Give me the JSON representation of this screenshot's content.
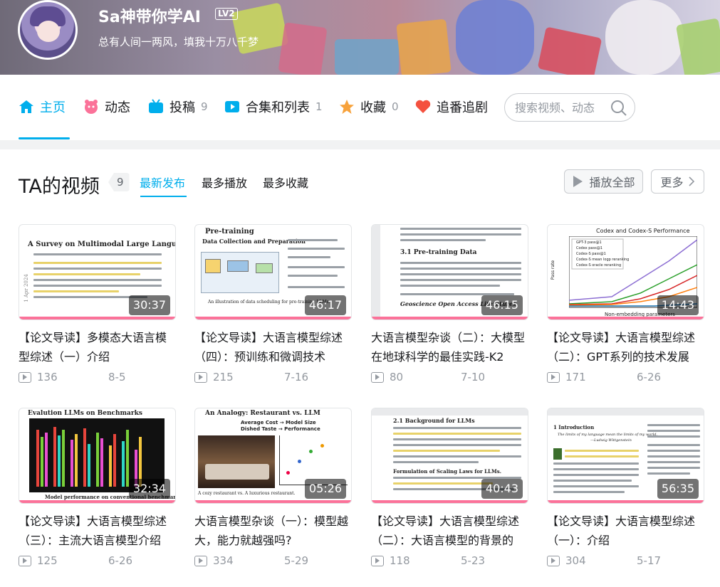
{
  "header": {
    "user_name": "Sa神带你学AI",
    "level": "LV2",
    "signature": "总有人间一两风，填我十万八千梦"
  },
  "nav": {
    "home": {
      "label": "主页"
    },
    "dynamic": {
      "label": "动态"
    },
    "posts": {
      "label": "投稿",
      "count": "9"
    },
    "collections": {
      "label": "合集和列表",
      "count": "1"
    },
    "favorites": {
      "label": "收藏",
      "count": "0"
    },
    "bangumi": {
      "label": "追番追剧"
    },
    "search_placeholder": "搜索视频、动态"
  },
  "colors": {
    "accent": "#00aeec",
    "pink": "#fb7299"
  },
  "section": {
    "title": "TA的视频",
    "count": "9",
    "sort_tabs": [
      "最新发布",
      "最多播放",
      "最多收藏"
    ],
    "play_all": "播放全部",
    "more": "更多"
  },
  "videos": [
    {
      "duration": "30:37",
      "title": "【论文导读】多模态大语言模型综述（一）介绍",
      "plays": "136",
      "date": "8-5",
      "thumb": {
        "heading": "A Survey on Multimodal Large Language Models",
        "side": "1 Apr 2024"
      }
    },
    {
      "duration": "46:17",
      "title": "【论文导读】大语言模型综述（四）：预训练和微调技术",
      "plays": "215",
      "date": "7-16",
      "thumb": {
        "heading": "Pre-training",
        "sub": "Data Collection and Preparation",
        "caption": "An illustration of data scheduling for pre-training LLMs."
      }
    },
    {
      "duration": "46:15",
      "title": "大语言模型杂谈（二）：大模型在地球科学的最佳实践-K2",
      "plays": "80",
      "date": "7-10",
      "thumb": {
        "heading": "3.1   Pre-training Data",
        "sub": "Geoscience Open Access Literatures."
      }
    },
    {
      "duration": "14:43",
      "title": "【论文导读】大语言模型综述（二）：GPT系列的技术发展",
      "plays": "171",
      "date": "6-26",
      "thumb": {
        "heading": "Codex and Codex-S Performance",
        "xlabel": "Non-embedding parameters",
        "ylabel": "Pass rate",
        "legend": [
          "GPT-3 pass@1",
          "Codex pass@1",
          "Codex-S pass@1",
          "Codex-S mean logp reranking",
          "Codex-S oracle reranking"
        ]
      }
    },
    {
      "duration": "32:34",
      "title": "【论文导读】大语言模型综述（三）：主流大语言模型介绍",
      "plays": "125",
      "date": "6-26",
      "thumb": {
        "heading": "Evalution LLMs on Benchmarks",
        "caption": "Model performance on conventional benchmarks"
      }
    },
    {
      "duration": "05:26",
      "title": "大语言模型杂谈（一）：模型越大，能力就越强吗?",
      "plays": "334",
      "date": "5-29",
      "thumb": {
        "heading": "An Analogy: Restaurant vs. LLM",
        "line1": "Average Cost → Model Size",
        "line2": "Dished Taste → Performance",
        "caption": "A cozy restaurant vs. A luxurious restaurant."
      }
    },
    {
      "duration": "40:43",
      "title": "【论文导读】大语言模型综述（二）：大语言模型的背景的",
      "plays": "118",
      "date": "5-23",
      "thumb": {
        "heading": "2.1   Background for LLMs",
        "sub": "Formulation of Scaling Laws for LLMs."
      }
    },
    {
      "duration": "56:35",
      "title": "【论文导读】大语言模型综述（一）：介绍",
      "plays": "304",
      "date": "5-17",
      "thumb": {
        "heading": "1   Introduction",
        "quote": "The limits of my language mean the limits of my world.",
        "author": "—Ludwig Wittgenstein"
      }
    }
  ]
}
